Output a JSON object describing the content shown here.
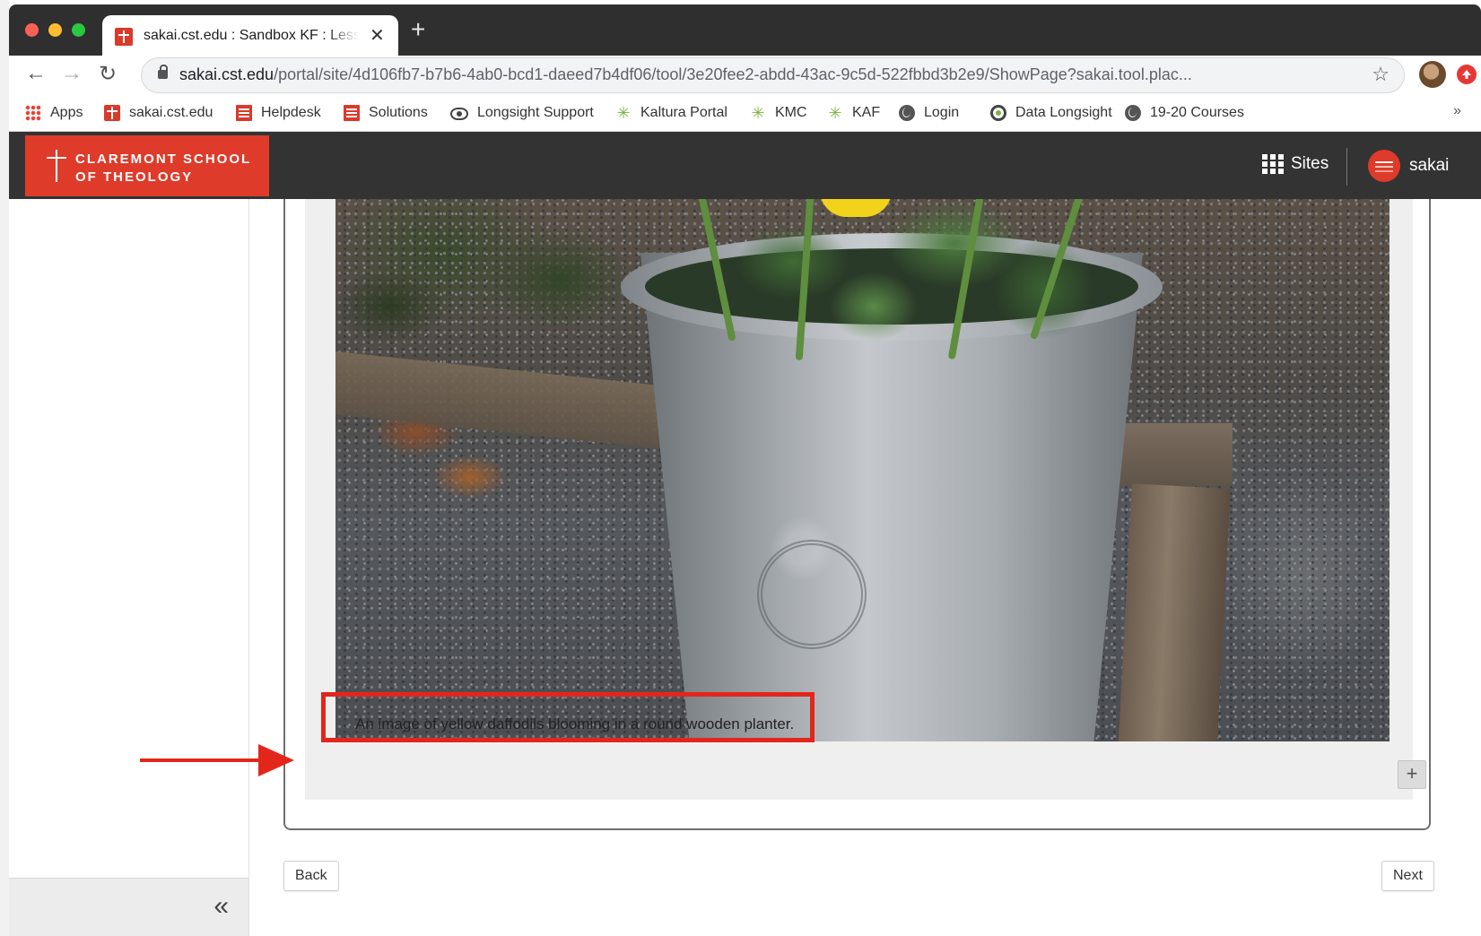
{
  "browser": {
    "tab_title": "sakai.cst.edu : Sandbox KF : Lessons",
    "tab_close": "✕",
    "new_tab": "+",
    "url_host": "sakai.cst.edu",
    "url_path": "/portal/site/4d106fb7-b7b6-4ab0-bcd1-daeed7b4df06/tool/3e20fee2-abdd-43ac-9c5d-522fbbd3b2e9/ShowPage?sakai.tool.plac...",
    "back": "←",
    "forward": "→",
    "reload": "↻",
    "star": "☆"
  },
  "bookmarks": [
    {
      "label": "Apps",
      "icon": "apps-icon"
    },
    {
      "label": "sakai.cst.edu",
      "icon": "cst-icon"
    },
    {
      "label": "Helpdesk",
      "icon": "doc-icon"
    },
    {
      "label": "Solutions",
      "icon": "doc-icon"
    },
    {
      "label": "Longsight Support",
      "icon": "eye-icon"
    },
    {
      "label": "Kaltura Portal",
      "icon": "spark-icon"
    },
    {
      "label": "KMC",
      "icon": "spark-icon"
    },
    {
      "label": "KAF",
      "icon": "spark-icon"
    },
    {
      "label": "Login",
      "icon": "globe-icon"
    },
    {
      "label": "Data Longsight",
      "icon": "ring-icon"
    },
    {
      "label": "19-20 Courses",
      "icon": "globe-icon"
    }
  ],
  "bookmarks_more": "»",
  "header": {
    "logo_line1": "Claremont School",
    "logo_line2": "of Theology",
    "sites_label": "Sites",
    "user_label": "sakai",
    "brand_color": "#de3b2a"
  },
  "sidebar": {
    "collapse": "«"
  },
  "content": {
    "caption": "An image of yellow daffodils blooming in a round wooden planter.",
    "expand": "+",
    "highlight_color": "#e3261c"
  },
  "nav": {
    "back_label": "Back",
    "next_label": "Next"
  }
}
